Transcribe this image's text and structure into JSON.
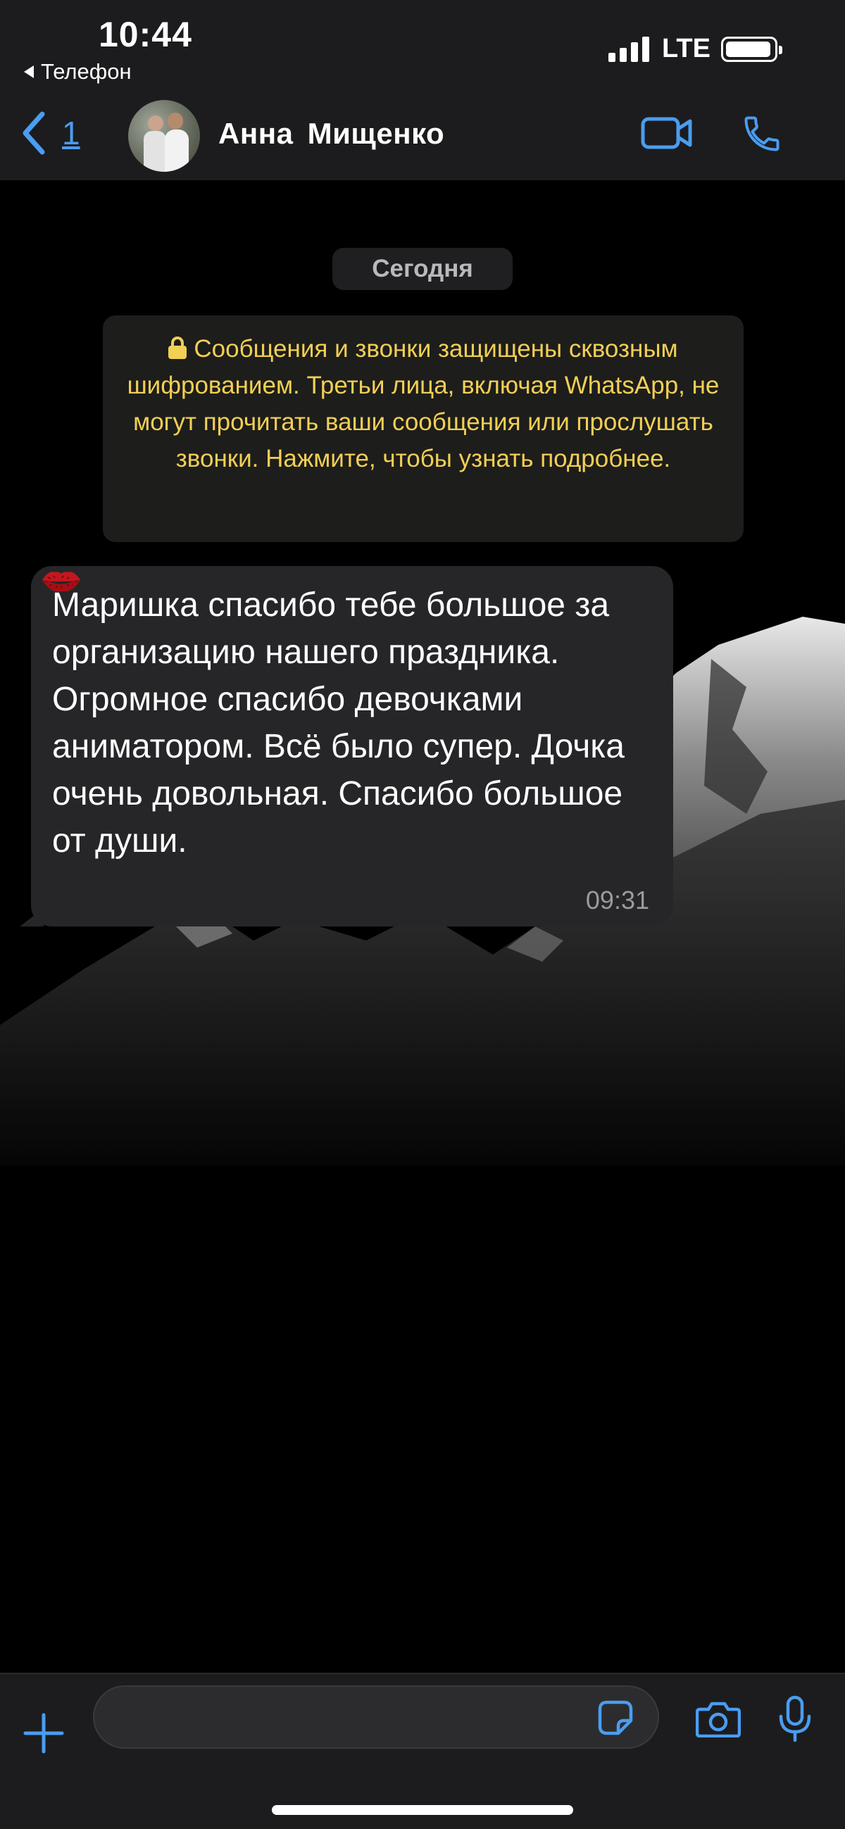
{
  "status_bar": {
    "time": "10:44",
    "back_app": "Телефон",
    "network": "LTE",
    "signal_bars": 4,
    "battery_level": 0.95
  },
  "header": {
    "back_count": "1",
    "contact_name": "Анна  Мищенко",
    "icons": [
      "chevron-left-icon",
      "video-camera-icon",
      "phone-icon"
    ]
  },
  "chat": {
    "date_label": "Сегодня",
    "encryption_notice": "Сообщения и звонки защищены сквозным шифрованием. Третьи лица, включая WhatsApp, не могут прочитать ваши сообщения или прослушать звонки. Нажмите, чтобы узнать подробнее.",
    "messages": [
      {
        "direction": "incoming",
        "text": "Маришка спасибо тебе большое за организацию нашего праздника. Огромное спасибо девочками аниматором. Всё было супер. Дочка очень довольная. Спасибо большое от души.",
        "emoji": [
          "kiss-mark",
          "kiss-mark",
          "kiss-mark",
          "kiss-mark"
        ],
        "time": "09:31"
      }
    ]
  },
  "input_bar": {
    "text_value": "",
    "icons": [
      "plus-icon",
      "sticker-icon",
      "camera-icon",
      "microphone-icon"
    ]
  },
  "colors": {
    "accent": "#4a9df0",
    "notice_text": "#f2cf55",
    "bubble": "#262628",
    "bar_bg": "#1c1c1e"
  }
}
